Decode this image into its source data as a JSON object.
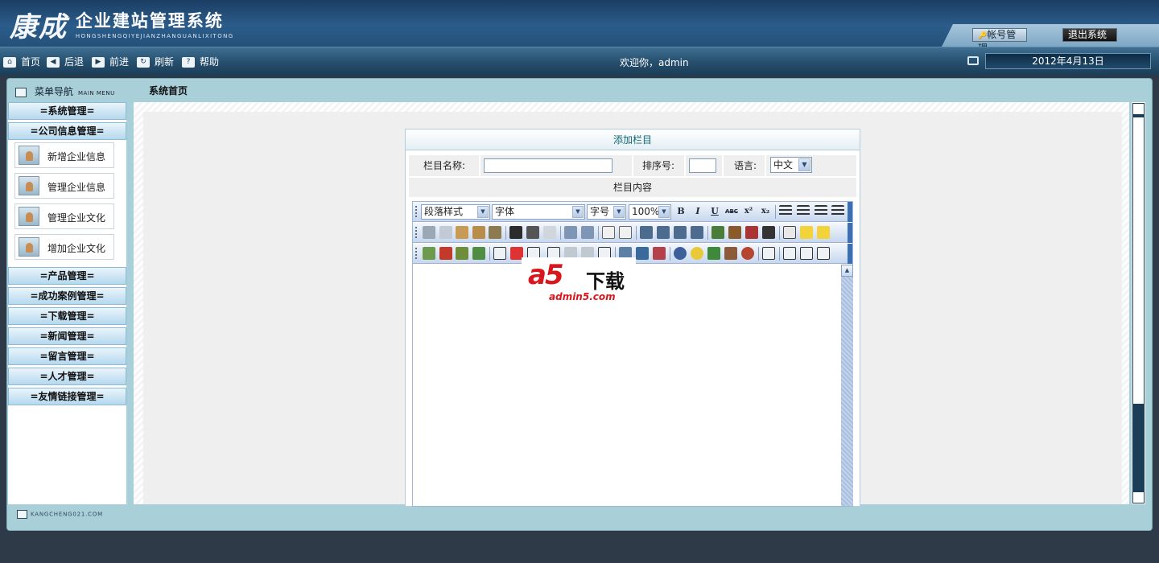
{
  "header": {
    "brand": "康成",
    "title": "企业建站管理系统",
    "subtitle": "HONGSHENGQIYEJIANZHANGUANLIXITONG",
    "account_button": "帐号管理",
    "logout_button": "退出系统"
  },
  "toolbar": {
    "home": "首页",
    "back": "后退",
    "forward": "前进",
    "refresh": "刷新",
    "help": "帮助",
    "welcome": "欢迎你，admin",
    "date": "2012年4月13日"
  },
  "menu": {
    "title": "菜单导航",
    "title_en": "MAIN MENU",
    "groups": [
      "=系统管理=",
      "=公司信息管理=",
      "=产品管理=",
      "=成功案例管理=",
      "=下载管理=",
      "=新闻管理=",
      "=留言管理=",
      "=人才管理=",
      "=友情链接管理="
    ],
    "company_items": [
      "新增企业信息",
      "管理企业信息",
      "管理企业文化",
      "增加企业文化"
    ]
  },
  "breadcrumb": "系统首页",
  "footer_logo": "KANGCHENG021.COM",
  "form": {
    "title": "添加栏目",
    "name_label": "栏目名称:",
    "name_value": "",
    "order_label": "排序号:",
    "order_value": "",
    "lang_label": "语言:",
    "lang_value": "中文",
    "content_label": "栏目内容"
  },
  "editor": {
    "paragraph_style": "段落样式",
    "font": "字体",
    "font_size": "字号",
    "zoom": "100%",
    "bold": "B",
    "italic": "I",
    "underline": "U",
    "strike": "ABC",
    "sup": "x²",
    "sub": "x₂"
  },
  "watermark": {
    "logo": "a5",
    "text": "下载",
    "url": "admin5.com"
  },
  "colors": {
    "header_bg": "#2b5c8a",
    "frame_bg": "#a9cfd9",
    "panel_title": "#0d6a74",
    "watermark_red": "#d9161c"
  }
}
